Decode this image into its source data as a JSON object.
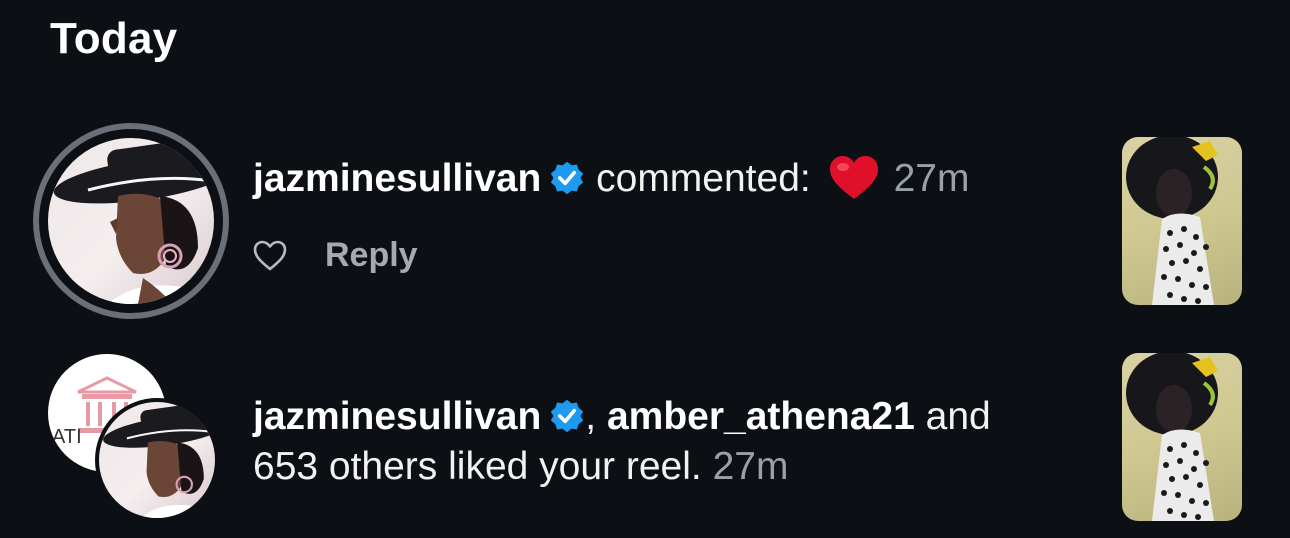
{
  "section": {
    "title": "Today"
  },
  "notifications": [
    {
      "username": "jazminesullivan",
      "action": "commented:",
      "time": "27m",
      "reply_label": "Reply"
    },
    {
      "username1": "jazminesullivan",
      "username2": "amber_athena21",
      "conj": "and",
      "text": "653 others liked your reel.",
      "time": "27m",
      "avatar_back_text": "ATI"
    }
  ],
  "colors": {
    "background": "#0c0f14",
    "verified": "#1d9bf0",
    "muted": "#9aa0a8",
    "heart": "#e0102b"
  },
  "icons": [
    "verified-badge-icon",
    "heart-emoji-icon",
    "heart-outline-icon"
  ]
}
